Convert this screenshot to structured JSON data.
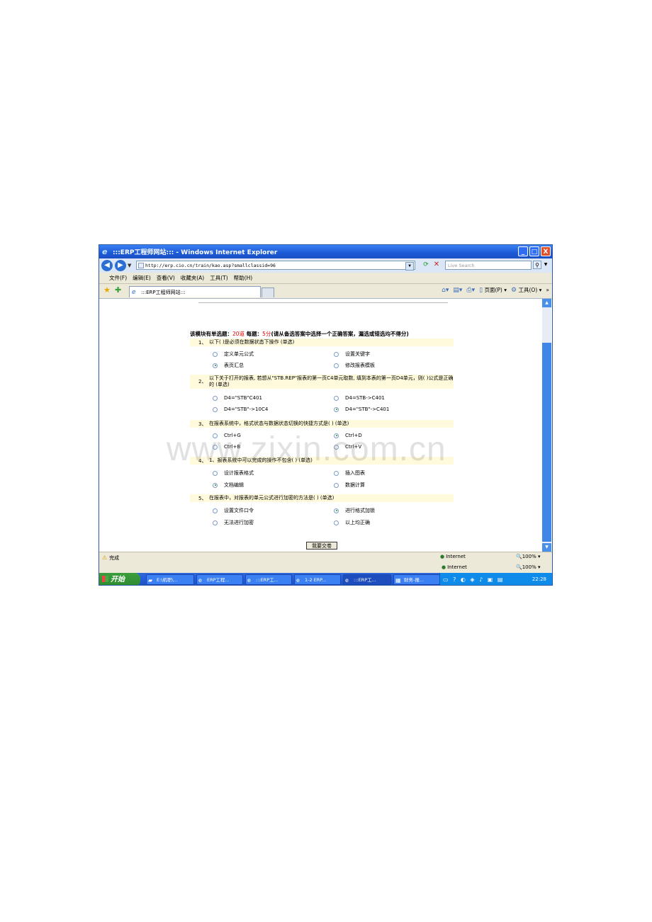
{
  "window": {
    "title": ":::ERP工程师网站::: - Windows Internet Explorer",
    "minimize": "_",
    "maximize": "□",
    "close": "X"
  },
  "address": {
    "back_icon": "back-arrow-icon",
    "url": "http://erp.cio.cn/train/kao.asp?smallclassid=96",
    "search_placeholder": "Live Search"
  },
  "menu": [
    "文件(F)",
    "编辑(E)",
    "查看(V)",
    "收藏夹(A)",
    "工具(T)",
    "帮助(H)"
  ],
  "tab": {
    "label": ":::ERP工程师网站:::"
  },
  "command_bar": {
    "page": "页面(P)",
    "tools": "工具(O)"
  },
  "quiz": {
    "heading_pre": "该模块有单选题：",
    "count": "20道",
    "heading_mid": "  每题：",
    "points": "5分",
    "heading_post": "(请从备选答案中选择一个正确答案，漏选或错选均不得分)",
    "questions": [
      {
        "num": "1、",
        "text": "以下(   )是必须在数据状态下操作 (单选)",
        "options": [
          {
            "label": "定义单元公式",
            "selected": false
          },
          {
            "label": "设置关键字",
            "selected": false
          },
          {
            "label": "表页汇总",
            "selected": true
          },
          {
            "label": "修改报表模板",
            "selected": false
          }
        ]
      },
      {
        "num": "2、",
        "text": "以下关于打开的报表, 若想从\"STB.REP\"报表的第一页C4单元取数, 填到本表的第一页D4单元，则(   )公式是正确的 (单选)",
        "options": [
          {
            "label": "D4=\"STB\"C401",
            "selected": false
          },
          {
            "label": "D4=STB->C401",
            "selected": false
          },
          {
            "label": "D4=\"STB\"->10C4",
            "selected": false
          },
          {
            "label": "D4=\"STB\"->C401",
            "selected": true
          }
        ]
      },
      {
        "num": "3、",
        "text": "在报表系统中，格式状态与数据状态切换的快捷方式是(   ) (单选)",
        "options": [
          {
            "label": "Ctrl+G",
            "selected": false
          },
          {
            "label": "Ctrl+D",
            "selected": true
          },
          {
            "label": "Ctrl+B",
            "selected": false
          },
          {
            "label": "Ctrl+V",
            "selected": false
          }
        ]
      },
      {
        "num": "4、",
        "text": "1、报表系统中可以完成的操作不包含(   ) (单选)",
        "options": [
          {
            "label": "设计报表格式",
            "selected": false
          },
          {
            "label": "插入图表",
            "selected": false
          },
          {
            "label": "文档编辑",
            "selected": true
          },
          {
            "label": "数据计算",
            "selected": false
          }
        ]
      },
      {
        "num": "5、",
        "text": "在报表中，对报表的单元公式进行加密的方法是(   ) (单选)",
        "options": [
          {
            "label": "设置文件口令",
            "selected": false
          },
          {
            "label": "进行格式加锁",
            "selected": true
          },
          {
            "label": "无法进行加密",
            "selected": false
          },
          {
            "label": "以上均正确",
            "selected": false
          }
        ]
      }
    ],
    "submit_label": "我要交卷"
  },
  "watermark": "www.zixin.com.cn",
  "status": {
    "text": "完成",
    "zone": "Internet",
    "zoom": "100%"
  },
  "taskbar": {
    "start": "开始",
    "items": [
      {
        "label": "E:\\机职\\..."
      },
      {
        "label": "ERP工程..."
      },
      {
        "label": ":::ERP工..."
      },
      {
        "label": "1-2 ERP..."
      },
      {
        "label": ":::ERP工..."
      },
      {
        "label": "财务-报..."
      }
    ],
    "clock": "22:28"
  }
}
